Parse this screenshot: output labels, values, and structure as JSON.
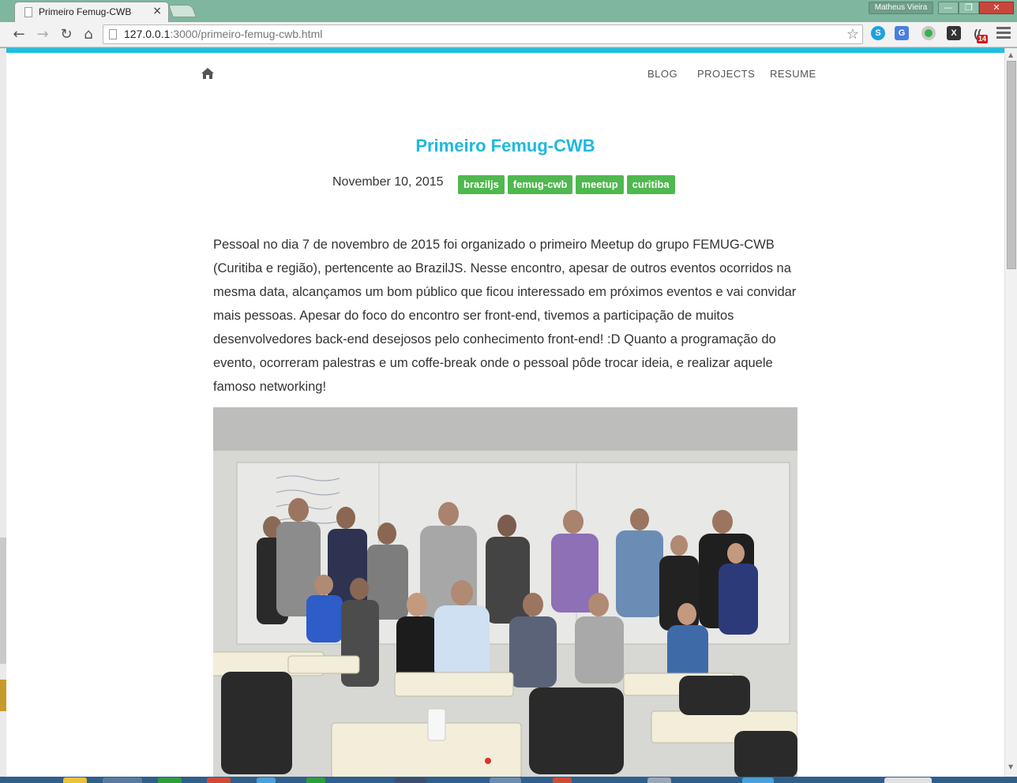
{
  "browser": {
    "tab_title": "Primeiro Femug-CWB",
    "tab_close": "×",
    "user_name": "Matheus Vieira",
    "url_host": "127.0.0.1",
    "url_rest": ":3000/primeiro-femug-cwb.html",
    "notification_count": "14",
    "window_buttons": {
      "minimize": "—",
      "maximize": "❐",
      "close": "✕"
    },
    "nav": {
      "back": "←",
      "forward": "→",
      "reload": "↻",
      "home": "⌂",
      "star": "☆"
    }
  },
  "site": {
    "nav": {
      "home_icon": "home-icon",
      "blog": "BLOG",
      "projects": "PROJECTS",
      "resume": "RESUME"
    }
  },
  "post": {
    "title": "Primeiro Femug-CWB",
    "date": "November 10, 2015",
    "tags": [
      "braziljs",
      "femug-cwb",
      "meetup",
      "curitiba"
    ],
    "body": "Pessoal no dia 7 de novembro de 2015 foi organizado o primeiro Meetup do grupo FEMUG-CWB (Curitiba e região), pertencente ao BrazilJS. Nesse encontro, apesar de outros eventos ocorridos na mesma data, alcançamos um bom público que ficou interessado em próximos eventos e vai convidar mais pessoas. Apesar do foco do encontro ser front-end, tivemos a participação de muitos desenvolvedores back-end desejosos pelo conhecimento front-end! :D Quanto a programação do evento, ocorreram palestras e um coffe-break onde o pessoal pôde trocar ideia, e realizar aquele famoso networking!"
  },
  "colors": {
    "accent": "#1fbde2",
    "tag": "#4fb84f",
    "title": "#1fb8df"
  }
}
